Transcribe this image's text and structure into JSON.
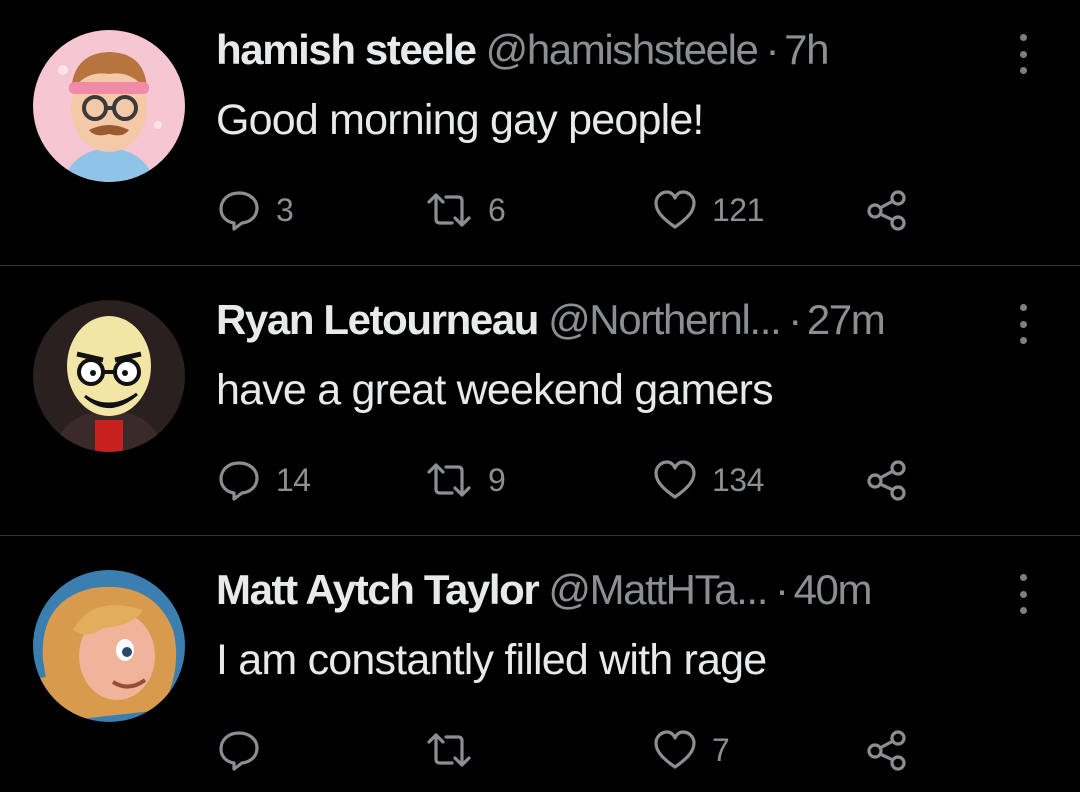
{
  "tweets": [
    {
      "name": "hamish steele",
      "handle": "@hamishsteele",
      "separator": "·",
      "time": "7h",
      "text": "Good morning gay people!",
      "replies": "3",
      "retweets": "6",
      "likes": "121"
    },
    {
      "name": "Ryan Letourneau",
      "handle": "@Northernl...",
      "separator": "·",
      "time": "27m",
      "text": "have a great weekend gamers",
      "replies": "14",
      "retweets": "9",
      "likes": "134"
    },
    {
      "name": "Matt Aytch Taylor",
      "handle": "@MattHTa...",
      "separator": "·",
      "time": "40m",
      "text": "I am constantly filled with rage",
      "replies": "",
      "retweets": "",
      "likes": "7"
    }
  ],
  "colors": {
    "background": "#000000",
    "text_primary": "#e7e9ea",
    "text_secondary": "#8b8f94",
    "divider": "#2f3336"
  },
  "icons": {
    "reply": "speech-bubble-icon",
    "retweet": "retweet-arrows-icon",
    "like": "heart-icon",
    "share": "share-nodes-icon",
    "more": "vertical-ellipsis-icon"
  }
}
